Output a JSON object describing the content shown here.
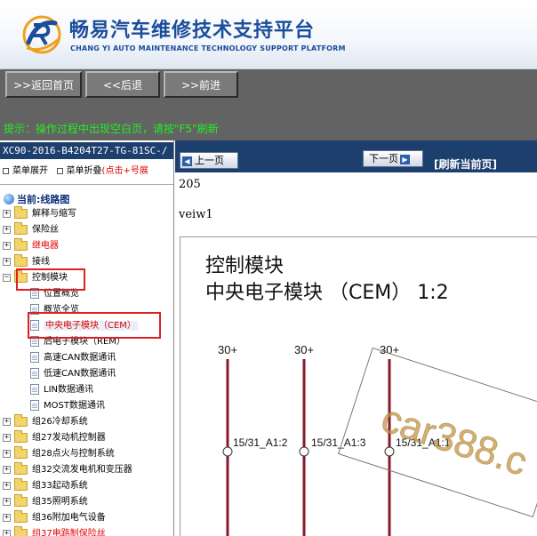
{
  "header": {
    "title": "畅易汽车维修技术支持平台",
    "subtitle": "CHANG YI AUTO MAINTENANCE TECHNOLOGY SUPPORT PLATFORM",
    "brand_color": "#1a4d9b"
  },
  "nav": {
    "home": ">>返回首页",
    "back": "<<后退",
    "forward": ">>前进"
  },
  "tip": "提示：操作过程中出现空白页，请按\"F5\"刷新",
  "left": {
    "doc_title": "XC90-2016-B4204T27-TG-81SC-/",
    "expand": "菜单展开",
    "collapse": "菜单折叠",
    "collapse_hint": "(点击+号展",
    "current_prefix": "当前:",
    "current_value": "线路图",
    "tree": [
      {
        "label": "解释与缩写"
      },
      {
        "label": "保险丝"
      },
      {
        "label": "继电器"
      },
      {
        "label": "接线"
      },
      {
        "label": "控制模块"
      },
      {
        "label": "位置概览"
      },
      {
        "label": "概览全览"
      },
      {
        "label": "中央电子模块（CEM）"
      },
      {
        "label": "后电子模块（REM）"
      },
      {
        "label": "高速CAN数据通讯"
      },
      {
        "label": "低速CAN数据通讯"
      },
      {
        "label": "LIN数据通讯"
      },
      {
        "label": "MOST数据通讯"
      },
      {
        "label": "组26冷却系统"
      },
      {
        "label": "组27发动机控制器"
      },
      {
        "label": "组28点火与控制系统"
      },
      {
        "label": "组32交流发电机和变压器"
      },
      {
        "label": "组33起动系统"
      },
      {
        "label": "组35照明系统"
      },
      {
        "label": "组36附加电气设备"
      },
      {
        "label": "组37电路制保险丝"
      }
    ]
  },
  "right": {
    "prev": "上一页",
    "next": "下一页",
    "refresh": "[刷新当前页]",
    "page_number": "205",
    "view_label": "veiw1",
    "diagram": {
      "title1": "控制模块",
      "title2": "中央电子模块 （CEM） 1:2",
      "supply": [
        "30+",
        "30+",
        "30+"
      ],
      "pins": [
        "15/31_A1:2",
        "15/31_A1:3",
        "15/31_A1:1"
      ],
      "watermark": "car388.c"
    }
  }
}
